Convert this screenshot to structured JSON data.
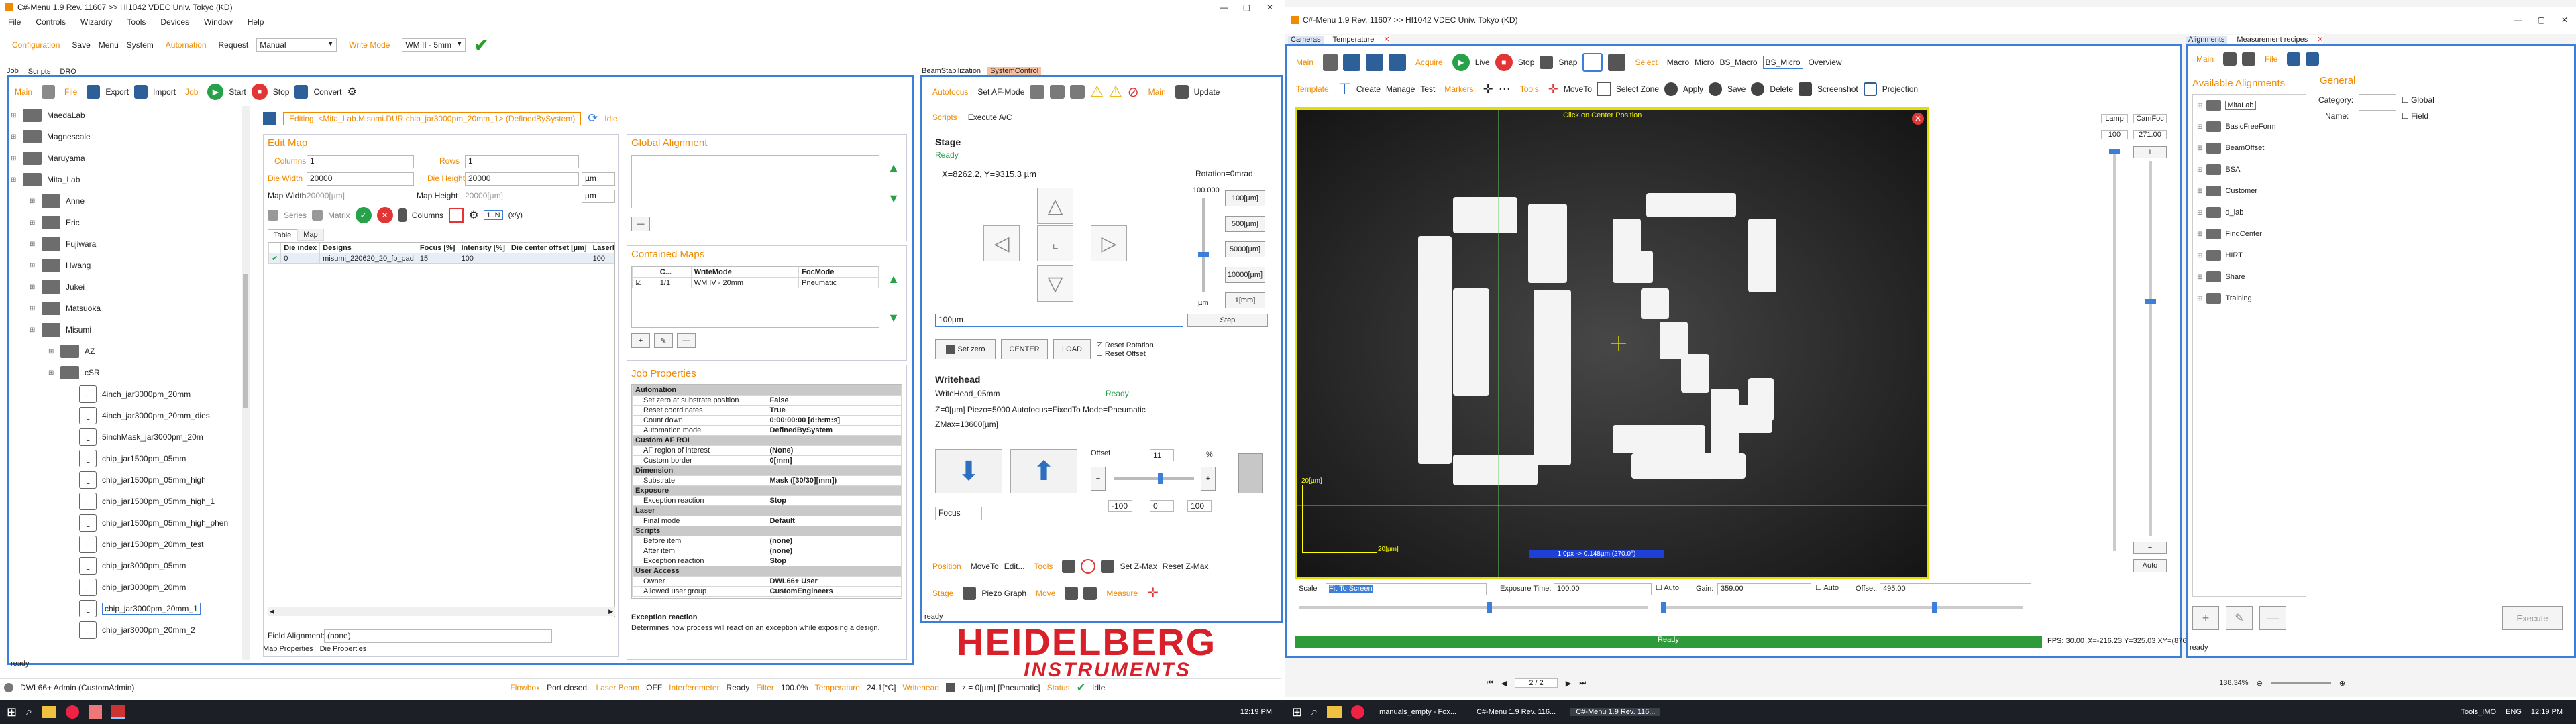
{
  "left_window": {
    "title": "C#-Menu 1.9 Rev. 11607 >> HI1042 VDEC Univ. Tokyo (KD)",
    "menu": [
      "File",
      "Controls",
      "Wizardry",
      "Tools",
      "Devices",
      "Window",
      "Help"
    ],
    "toolbar": {
      "configuration": "Configuration",
      "save": "Save",
      "menu": "Menu",
      "system": "System",
      "automation": "Automation",
      "request_label": "Request",
      "request_value": "Manual",
      "write_mode_label": "Write Mode",
      "write_mode_value": "WM II - 5mm"
    },
    "tabs": [
      "Job",
      "Scripts",
      "DRO"
    ],
    "job_toolbar": {
      "main": "Main",
      "file": "File",
      "export": "Export",
      "import": "Import",
      "job": "Job",
      "start": "Start",
      "stop": "Stop",
      "convert": "Convert"
    },
    "tree": {
      "items": [
        {
          "label": "MaedaLab",
          "level": 1,
          "type": "folder"
        },
        {
          "label": "Magnescale",
          "level": 1,
          "type": "folder"
        },
        {
          "label": "Maruyama",
          "level": 1,
          "type": "folder"
        },
        {
          "label": "Mita_Lab",
          "level": 1,
          "type": "folder"
        },
        {
          "label": "Anne",
          "level": 2,
          "type": "folder"
        },
        {
          "label": "Eric",
          "level": 2,
          "type": "folder"
        },
        {
          "label": "Fujiwara",
          "level": 2,
          "type": "folder"
        },
        {
          "label": "Hwang",
          "level": 2,
          "type": "folder"
        },
        {
          "label": "Jukei",
          "level": 2,
          "type": "folder"
        },
        {
          "label": "Matsuoka",
          "level": 2,
          "type": "folder"
        },
        {
          "label": "Misumi",
          "level": 2,
          "type": "folder"
        },
        {
          "label": "AZ",
          "level": 3,
          "type": "folder"
        },
        {
          "label": "cSR",
          "level": 3,
          "type": "folder"
        },
        {
          "label": "4inch_jar3000pm_20mm",
          "level": 4,
          "type": "job"
        },
        {
          "label": "4inch_jar3000pm_20mm_dies",
          "level": 4,
          "type": "job"
        },
        {
          "label": "5inchMask_jar3000pm_20m",
          "level": 4,
          "type": "job"
        },
        {
          "label": "chip_jar1500pm_05mm",
          "level": 4,
          "type": "job"
        },
        {
          "label": "chip_jar1500pm_05mm_high",
          "level": 4,
          "type": "job"
        },
        {
          "label": "chip_jar1500pm_05mm_high_1",
          "level": 4,
          "type": "job"
        },
        {
          "label": "chip_jar1500pm_05mm_high_phen",
          "level": 4,
          "type": "job"
        },
        {
          "label": "chip_jar1500pm_20mm_test",
          "level": 4,
          "type": "job"
        },
        {
          "label": "chip_jar3000pm_05mm",
          "level": 4,
          "type": "job"
        },
        {
          "label": "chip_jar3000pm_20mm",
          "level": 4,
          "type": "job"
        },
        {
          "label": "chip_jar3000pm_20mm_1",
          "level": 4,
          "type": "job"
        },
        {
          "label": "chip_jar3000pm_20mm_2",
          "level": 4,
          "type": "job"
        }
      ]
    },
    "editing_label": "Editing: <Mita_Lab.Misumi.DUR.chip_jar3000pm_20mm_1> (DefinedBySystem)",
    "idle": "Idle",
    "edit_map": {
      "title": "Edit Map",
      "columns_label": "Columns",
      "columns_value": "1",
      "rows_label": "Rows",
      "rows_value": "1",
      "die_width_label": "Die Width",
      "die_width_value": "20000",
      "die_height_label": "Die Height",
      "die_height_value": "20000",
      "unit": "µm",
      "map_width_label": "Map Width",
      "map_width_value": "20000[µm]",
      "map_height_label": "Map Height",
      "map_height_value": "20000[µm]",
      "series": "Series",
      "matrix": "Matrix",
      "columns_btn": "Columns"
    },
    "table_tabs": [
      "Table",
      "Map"
    ],
    "die_table": {
      "headers": [
        "Die index",
        "Designs",
        "Focus [%]",
        "Intensity [%]",
        "Die center offset [µm]",
        "LaserPower [n"
      ],
      "rows": [
        [
          "0",
          "misumi_220620_20_fp_pad",
          "15",
          "100",
          "",
          "100"
        ]
      ]
    },
    "field_alignment_label": "Field Alignment:",
    "field_alignment_value": "(none)",
    "bottom_tabs": [
      "Map Properties",
      "Die Properties"
    ],
    "global_alignment": "Global Alignment",
    "contained_maps": {
      "title": "Contained Maps",
      "headers": [
        "C...",
        "WriteMode",
        "FocMode"
      ],
      "rows": [
        [
          "1/1",
          "WM IV - 20mm",
          "Pneumatic"
        ]
      ]
    },
    "job_properties": {
      "title": "Job Properties",
      "rows": [
        {
          "cat": true,
          "k": "Automation",
          "v": ""
        },
        {
          "k": "Set zero at substrate position",
          "v": "False"
        },
        {
          "k": "Reset coordinates",
          "v": "True"
        },
        {
          "k": "Count down",
          "v": "0:00:00:00 [d:h:m:s]"
        },
        {
          "k": "Automation mode",
          "v": "DefinedBySystem"
        },
        {
          "cat": true,
          "k": "Custom AF ROI",
          "v": ""
        },
        {
          "k": "AF region of interest",
          "v": "(None)"
        },
        {
          "k": "Custom border",
          "v": "0[mm]"
        },
        {
          "cat": true,
          "k": "Dimension",
          "v": ""
        },
        {
          "k": "Substrate",
          "v": "Mask ([30/30][mm])"
        },
        {
          "cat": true,
          "k": "Exposure",
          "v": ""
        },
        {
          "k": "Exception reaction",
          "v": "Stop"
        },
        {
          "cat": true,
          "k": "Laser",
          "v": ""
        },
        {
          "k": "Final mode",
          "v": "Default"
        },
        {
          "cat": true,
          "k": "Scripts",
          "v": ""
        },
        {
          "k": "Before item",
          "v": "(none)"
        },
        {
          "k": "After item",
          "v": "(none)"
        },
        {
          "k": "Exception reaction",
          "v": "Stop"
        },
        {
          "cat": true,
          "k": "User Access",
          "v": ""
        },
        {
          "k": "Owner",
          "v": "DWL66+ User"
        },
        {
          "k": "Allowed user group",
          "v": "CustomEngineers"
        }
      ],
      "desc_title": "Exception reaction",
      "desc_text": "Determines how process will react on an exception while exposing a design."
    },
    "side_tabs": [
      "BeamStabilization",
      "SystemControl"
    ],
    "system_control": {
      "autofocus": "Autofocus",
      "set_af_mode": "Set AF-Mode",
      "main": "Main",
      "update": "Update",
      "scripts": "Scripts",
      "execute_aic": "Execute A/C",
      "stage_title": "Stage",
      "stage_status": "Ready",
      "stage_pos": "X=8262.2, Y=9315.3 µm",
      "rotation": "Rotation=0mrad",
      "slider_max": "100.000",
      "steps": [
        "100[µm]",
        "500[µm]",
        "5000[µm]",
        "10000[µm]",
        "1[mm]"
      ],
      "um": "µm",
      "step_value": "100µm",
      "step_btn": "Step",
      "set_zero": "Set zero",
      "center": "CENTER",
      "load": "LOAD",
      "reset_rotation": "Reset Rotation",
      "reset_offset": "Reset Offset",
      "writehead_title": "Writehead",
      "writehead_name": "WriteHead_05mm",
      "writehead_status": "Ready",
      "wh_line1": "Z=0[µm]   Piezo=5000   Autofocus=FixedTo   Mode=Pneumatic",
      "wh_line2": "ZMax=13600[µm]",
      "offset_label": "Offset",
      "offset_value": "11",
      "percent": "%",
      "scale_min": "-100",
      "scale_zero": "0",
      "scale_max": "100",
      "focus_select": "Focus",
      "position": "Position",
      "moveto": "MoveTo",
      "edit": "Edit...",
      "tools": "Tools",
      "set_zmax": "Set Z-Max",
      "reset_zmax": "Reset Z-Max",
      "stage": "Stage",
      "piezo_graph": "Piezo Graph",
      "move": "Move",
      "measure": "Measure",
      "ready": "ready"
    },
    "logo_line1": "HEIDELBERG",
    "logo_line2": "INSTRUMENTS",
    "status_left": "ready",
    "statusbar": {
      "user": "DWL66+ Admin (CustomAdmin)",
      "flowbox": "Flowbox",
      "flowbox_val": "Port closed.",
      "laser_beam": "Laser Beam",
      "laser_val": "OFF",
      "interferometer": "Interferometer",
      "interf_val": "Ready",
      "filter": "Filter",
      "filter_val": "100.0%",
      "temperature": "Temperature",
      "temp_val": "24.1[°C]",
      "writehead": "Writehead",
      "wh_val": "z = 0[µm] [Pneumatic]",
      "status": "Status",
      "status_val": "Idle"
    }
  },
  "right_window": {
    "title": "C#-Menu 1.9 Rev. 11607 >> HI1042 VDEC Univ. Tokyo (KD)",
    "tabs": [
      "Cameras",
      "Temperature"
    ],
    "cam_toolbar": {
      "main": "Main",
      "acquire": "Acquire",
      "live": "Live",
      "stop": "Stop",
      "snap": "Snap",
      "select": "Select",
      "macro": "Macro",
      "micro": "Micro",
      "bs_macro": "BS_Macro",
      "bs_micro": "BS_Micro",
      "overview": "Overview",
      "template": "Template",
      "create": "Create",
      "manage": "Manage",
      "test": "Test",
      "markers": "Markers",
      "tools": "Tools",
      "moveto": "MoveTo",
      "select_zone": "Select Zone",
      "apply": "Apply",
      "save": "Save",
      "delete": "Delete",
      "screenshot": "Screenshot",
      "projection": "Projection"
    },
    "camera": {
      "click_center": "Click on Center Position",
      "scale_y": "20[µm]",
      "scale_x": "20[µm]",
      "measure_label": "1.0px -> 0.148µm (270.0°)"
    },
    "lamp": {
      "label": "Lamp",
      "value": "100"
    },
    "camfoc": {
      "label": "CamFoc",
      "value": "271.00"
    },
    "auto": "Auto",
    "controls": {
      "scale_label": "Scale",
      "scale_value": "Fit To Screen",
      "exposure_label": "Exposure Time:",
      "exposure_value": "100.00",
      "auto": "Auto",
      "gain_label": "Gain:",
      "gain_value": "359.00",
      "offset_label": "Offset:",
      "offset_value": "495.00"
    },
    "status_ready": "Ready",
    "fps": "FPS: 30.00",
    "coords": "X=-216.23 Y=325.03 XY=(8765.5/8977.3)[µm]",
    "align_tabs": [
      "Alignments",
      "Measurement recipes"
    ],
    "align_toolbar": {
      "main": "Main",
      "file": "File"
    },
    "available_alignments": "Available Alignments",
    "align_items": [
      "MitaLab",
      "BasicFreeForm",
      "BeamOffset",
      "BSA",
      "Customer",
      "d_lab",
      "FindCenter",
      "HIRT",
      "Share",
      "Training"
    ],
    "general": {
      "title": "General",
      "category": "Category:",
      "name": "Name:",
      "global": "Global",
      "field": "Field"
    },
    "execute": "Execute",
    "ready": "ready",
    "bg_page": "2 / 2",
    "bg_zoom": "138.34%"
  },
  "taskbar": {
    "time1": "12:19 PM",
    "time2": "12:19 PM",
    "app1": "manuals_empty - Fox...",
    "app2": "C#-Menu 1.9 Rev. 116...",
    "app3": "C#-Menu 1.9 Rev. 116...",
    "user": "Tools_IMO",
    "lang": "ENG"
  }
}
